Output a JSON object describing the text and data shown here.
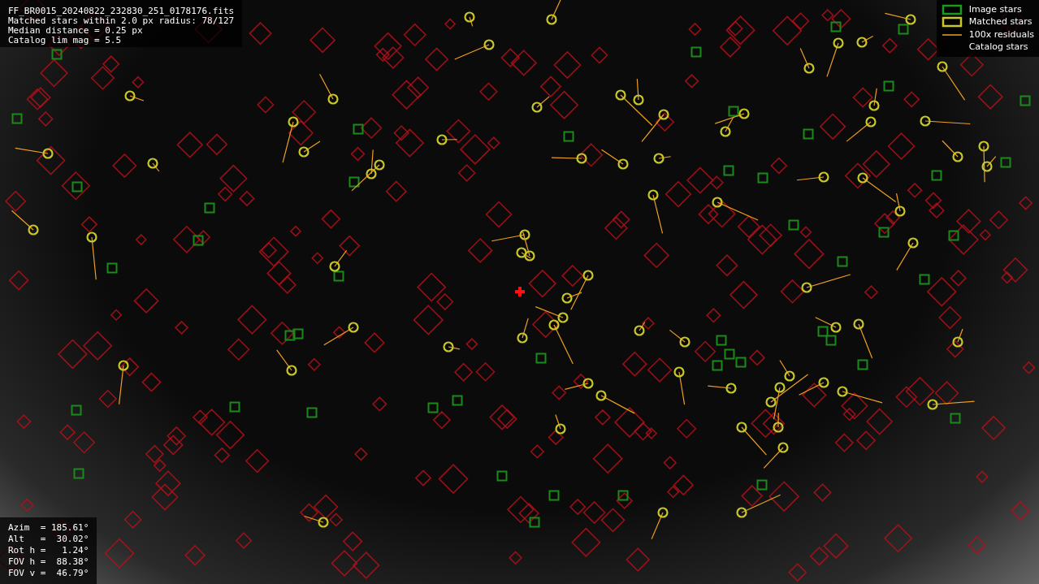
{
  "header": {
    "filename": "FF_BR0015_20240822_232830_251_0178176.fits",
    "lines": [
      "Matched stars within 2.0 px radius: 78/127",
      "Median distance = 0.25 px",
      "Catalog lim mag = 5.5"
    ]
  },
  "legend": [
    {
      "kind": "image",
      "label": "Image stars"
    },
    {
      "kind": "matched",
      "label": "Matched stars"
    },
    {
      "kind": "residual",
      "label": "100x residuals"
    },
    {
      "kind": "catalog",
      "label": "Catalog stars"
    }
  ],
  "pointing": [
    "Azim  = 185.61°",
    "Alt   =  30.02°",
    "Rot h =   1.24°",
    "FOV h =  88.38°",
    "FOV v =  46.79°"
  ]
}
